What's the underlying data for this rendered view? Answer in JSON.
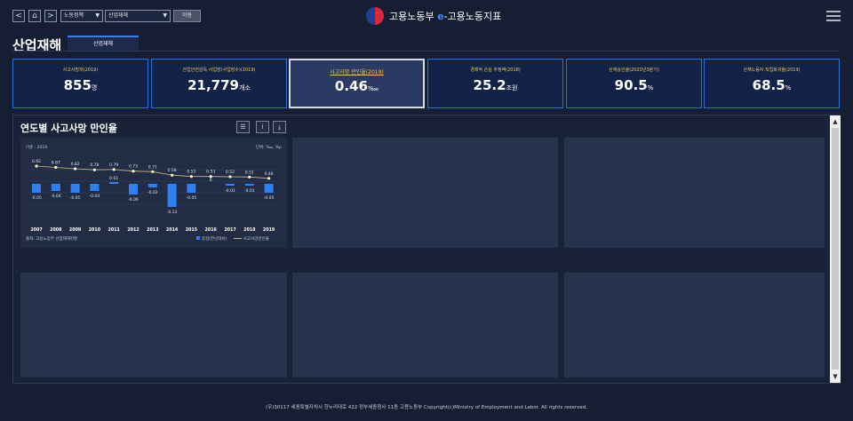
{
  "nav": {
    "back_label": "<",
    "home_label": "⌂",
    "forward_label": ">",
    "category_select": "노동정책",
    "page_select": "산업재해",
    "go_label": "이동"
  },
  "logo": {
    "ministry": "고용노동부",
    "e": "e",
    "service": "-고용노동지표"
  },
  "page": {
    "title": "산업재해",
    "tab": "산업재해"
  },
  "kpis": [
    {
      "label": "사고사망자(2019)",
      "value": "855",
      "unit": "명",
      "active": false
    },
    {
      "label": "산업안전감독 사업장(사업장수)(2019)",
      "value": "21,779",
      "unit": "개소",
      "active": false
    },
    {
      "label": "사고사망 만인율(2019)",
      "value": "0.46",
      "unit": "‱",
      "active": true
    },
    {
      "label": "경제적 손실 추정액(2018)",
      "value": "25.2",
      "unit": "조원",
      "active": false
    },
    {
      "label": "산재승인율(2020년3분기)",
      "value": "90.5",
      "unit": "%",
      "active": false
    },
    {
      "label": "산재노동자 직업복귀율(2019)",
      "value": "68.5",
      "unit": "%",
      "active": false
    }
  ],
  "panel": {
    "title": "연도별 사고사망 만인율"
  },
  "chart_meta": {
    "base": "기준 : 2019",
    "unit": "단위: ‱, %p",
    "source": "출처: 고용노동부 산업재해현황",
    "legend_bar": "증감(전년대비)",
    "legend_line": "사고사망만인율"
  },
  "chart_data": {
    "type": "bar",
    "categories": [
      "2007",
      "2008",
      "2009",
      "2010",
      "2011",
      "2012",
      "2013",
      "2014",
      "2015",
      "2016",
      "2017",
      "2018",
      "2019"
    ],
    "series": [
      {
        "name": "증감(전년대비)",
        "type": "bar",
        "values": [
          -0.05,
          -0.04,
          -0.05,
          -0.04,
          0.01,
          -0.06,
          -0.02,
          -0.13,
          -0.05,
          0,
          -0.01,
          -0.01,
          -0.05
        ],
        "labels": [
          "-0.05",
          "-0.04",
          "-0.05",
          "-0.04",
          "0.01",
          "-0.06",
          "-0.02",
          "-0.13",
          "-0.05",
          "0",
          "-0.01",
          "-0.01",
          "-0.05"
        ]
      },
      {
        "name": "사고사망만인율",
        "type": "line",
        "values": [
          0.92,
          0.87,
          0.82,
          0.78,
          0.79,
          0.73,
          0.71,
          0.58,
          0.53,
          0.53,
          0.52,
          0.51,
          0.46
        ],
        "labels": [
          "0.92",
          "0.87",
          "0.82",
          "0.78",
          "0.79",
          "0.73",
          "0.71",
          "0.58",
          "0.53",
          "0.53",
          "0.52",
          "0.51",
          "0.46"
        ]
      }
    ],
    "colors": {
      "bar": "#2f7ff5",
      "line": "#c9b98a",
      "marker": "#fff6c8"
    }
  },
  "footer": {
    "text": "(우)30117 세종특별자치시 한누리대로 422 정부세종청사 11동 고용노동부 Copyright(c)Ministry of Employment and Labor. All rights reserved."
  }
}
